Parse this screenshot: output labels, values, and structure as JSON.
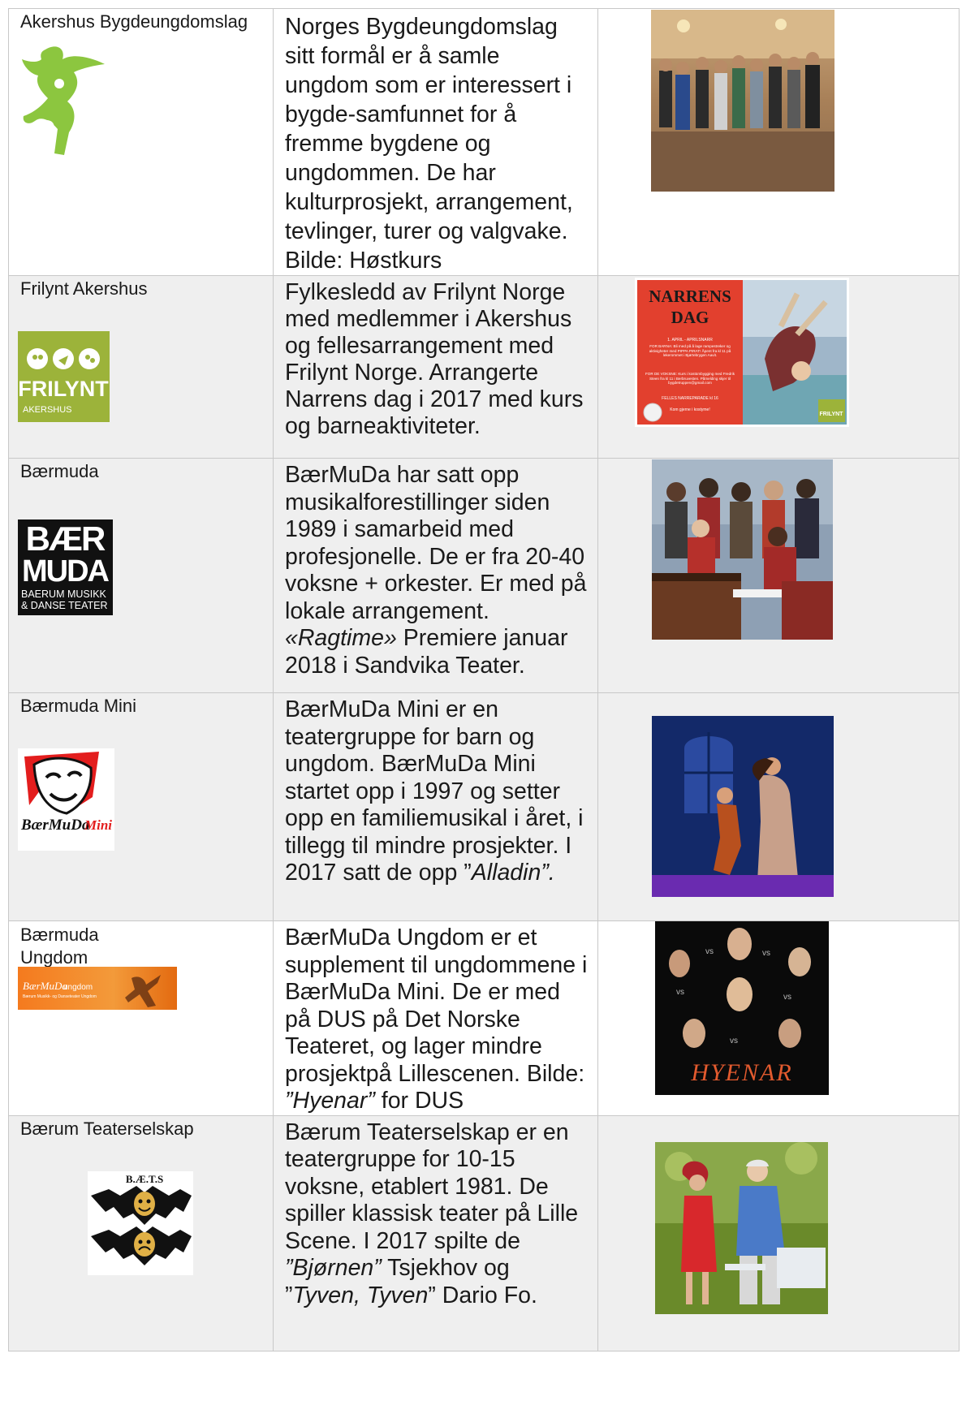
{
  "rows": [
    {
      "name": "Akershus Bygdeungdomslag",
      "desc_plain": "Norges Bygdeungdomslag sitt formål er å samle ungdom som er interessert i bygde-samfunnet for å fremme bygdene og ungdommen. De har kulturprosjekt, arrangement, tevlinger, turer og valgvake. Bilde: Høstkurs"
    },
    {
      "name": "Frilynt Akershus",
      "desc_plain": "Fylkesledd av Frilynt Norge med medlemmer i Akershus og fellesarrangement med Frilynt Norge. Arrangerte Narrens dag i 2017 med kurs og barneaktiviteter.",
      "logo_text": "FRILYNT",
      "logo_sub": "AKERSHUS",
      "poster": {
        "title1": "NARRENS",
        "title2": "DAG",
        "line1": "1. APRIL - APRILSNARR",
        "line2": "FOR BARNA: Bli med på å lage rampestreker og aktivigheter med PIPPA PIRAT! Åpent fra kl 11 på lekerommet i Bjørtebrygen Aavit.",
        "line3": "FOR DE VOKSNE: Kurs i kostümbygging med Fredrik Steen fra kl 11 i Berbruvesten. Påmelding skjer til bygdetruppen@gmail.com",
        "line4": "FELLES NARREPARADE kl 16",
        "line5": "Kom gjerne i kostyme!",
        "badge": "FRILYNT"
      }
    },
    {
      "name": "Bærmuda",
      "desc_lines": [
        "BærMuDa har satt opp musikalforestillinger siden 1989 i samarbeid med profesjonelle. De er fra 20-40 voksne + orkester. Er med på lokale arrangement. ",
        "«Ragtime»",
        " Premiere januar 2018 i Sandvika Teater."
      ],
      "logo_big1": "BÆR",
      "logo_big2": "MUDA",
      "logo_small1": "BAERUM MUSIKK",
      "logo_small2": "& DANSE TEATER"
    },
    {
      "name": "Bærmuda Mini",
      "desc_parts": [
        "BærMuDa Mini er en teatergruppe for barn og ungdom. BærMuDa Mini startet opp i 1997 og setter opp en familiemusikal i året, i tillegg til mindre prosjekter. I 2017 satt de opp ”",
        "Alladin”."
      ],
      "logo_text": "BærMuDa",
      "logo_text2": "Mini"
    },
    {
      "name1": "Bærmuda",
      "name2": "Ungdom",
      "desc_parts": [
        "BærMuDa Ungdom er et supplement til ungdommene i BærMuDa Mini. De er med på DUS på Det Norske Teateret, og lager mindre prosjektpå Lillescenen. Bilde: ",
        "”Hyenar”",
        " for DUS"
      ],
      "logo_text": "BærMuDa",
      "logo_text2": "ungdom",
      "logo_sub": "Bærum Musikk- og Danseteater Ungdom",
      "poster_title": "HYENAR",
      "vs": "vs"
    },
    {
      "name": "Bærum Teaterselskap",
      "desc_parts": [
        "Bærum Teaterselskap er en teatergruppe for 10-15 voksne, etablert 1981. De spiller klassisk teater på Lille Scene. I 2017 spilte de ",
        "”Bjørnen”",
        " Tsjekhov og ”",
        "Tyven, Tyven",
        "” Dario Fo."
      ],
      "logo_text": "B.Æ.T.S"
    }
  ]
}
